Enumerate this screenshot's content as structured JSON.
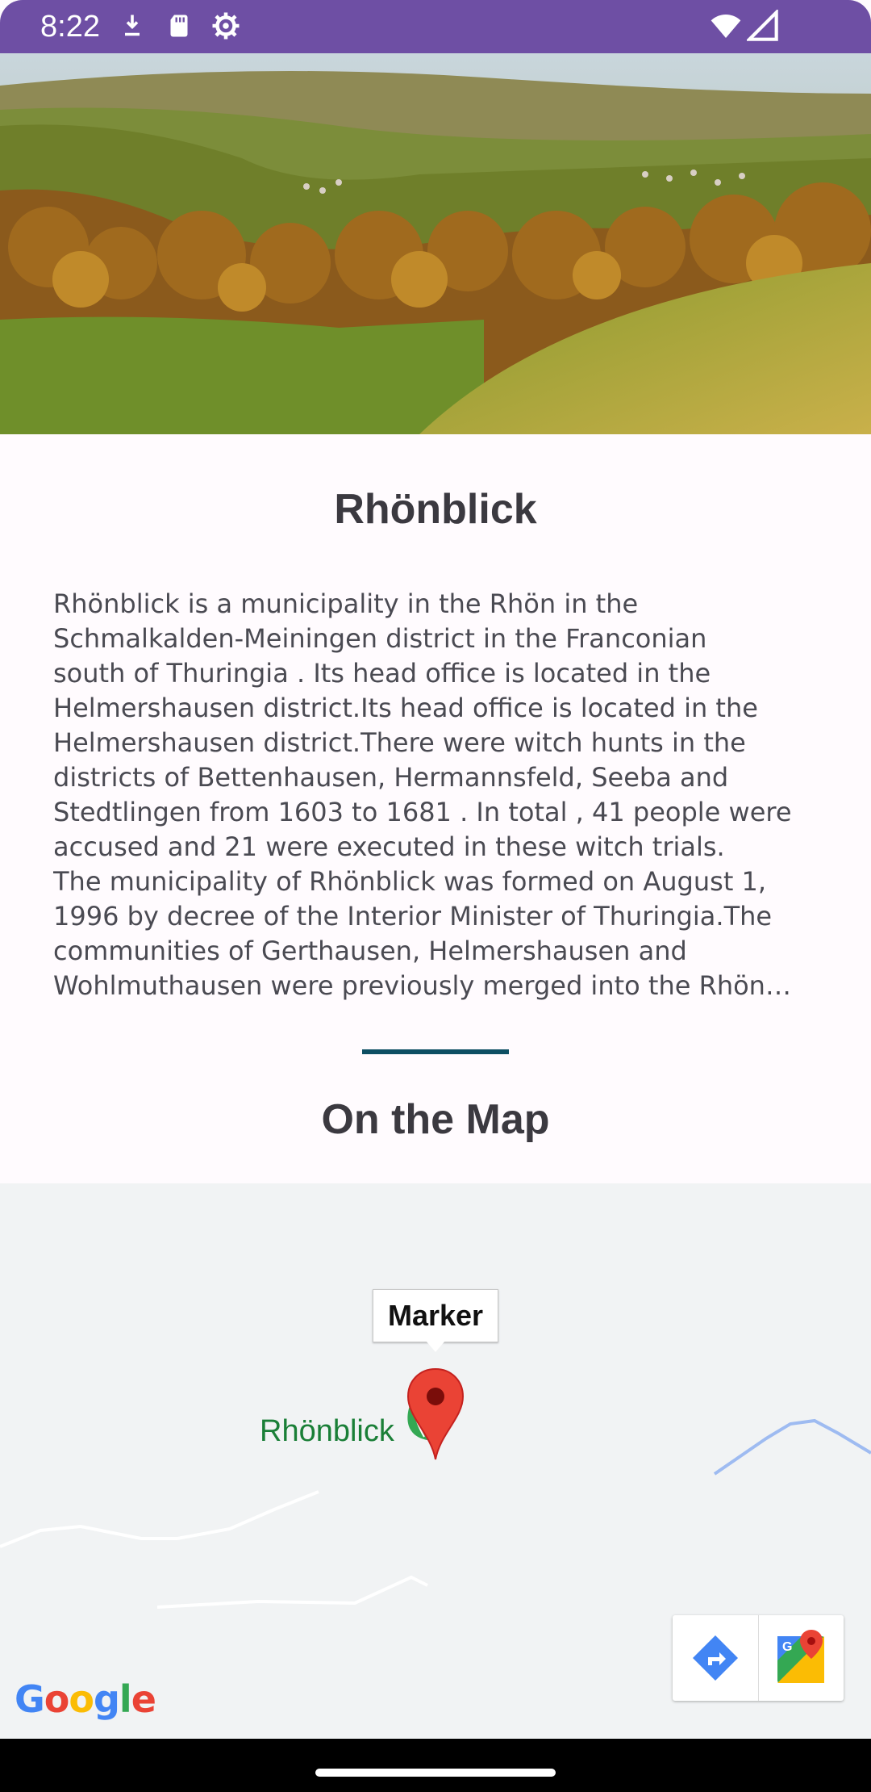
{
  "status_bar": {
    "time": "8:22",
    "icons": [
      "download-icon",
      "sd-card-icon",
      "settings-icon",
      "wifi-icon",
      "signal-icon"
    ],
    "background": "#6e4fa4"
  },
  "hero": {
    "image": "autumn-valley-landscape"
  },
  "place": {
    "title": "Rhönblick",
    "description_lines": [
      "Rhönblick is a municipality in the Rhön in the",
      "Schmalkalden-Meiningen district in the Franconian",
      "south of Thuringia . Its head office is located in the",
      "Helmershausen district.Its head office is located in the",
      "Helmershausen district.There were witch hunts in the",
      "districts of Bettenhausen, Hermannsfeld, Seeba and",
      "Stedtlingen from 1603 to 1681 . In total , 41 people were",
      "accused and 21 were executed in these witch trials.",
      "The municipality of Rhönblick was formed on August 1,",
      "1996 by decree of the Interior Minister of Thuringia.The",
      "communities of Gerthausen, Helmershausen and",
      "Wohlmuthausen were previously merged into the Rhön…"
    ]
  },
  "map_section": {
    "heading": "On the Map",
    "marker_label": "Marker",
    "place_label": "Rhönblick",
    "google_logo": "Google",
    "buttons": [
      "directions-icon",
      "google-maps-icon"
    ],
    "accent": "#0d4f63"
  }
}
